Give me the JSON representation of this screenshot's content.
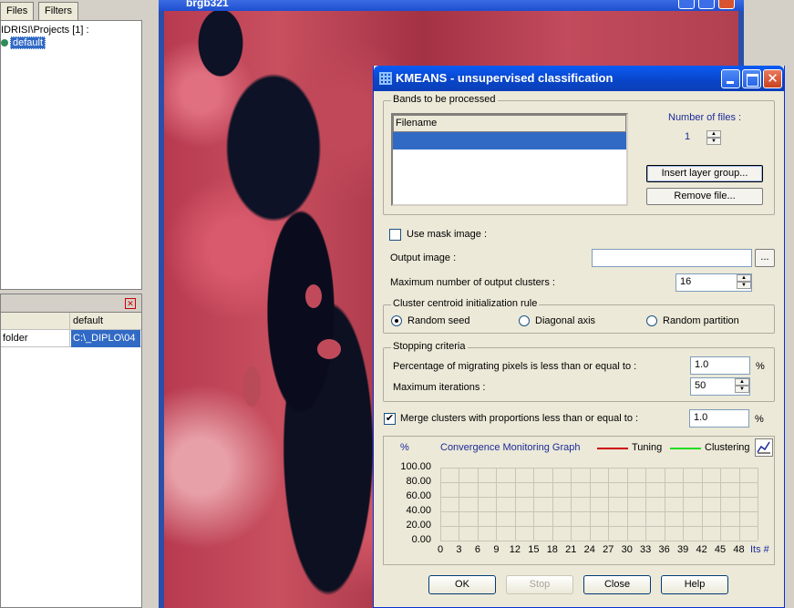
{
  "explorer": {
    "tabs": [
      "Files",
      "Filters"
    ],
    "tree_root": "IDRISI\\Projects [1] :",
    "tree_child": "default",
    "props_header": [
      "",
      "default"
    ],
    "props_row": [
      "folder",
      "C:\\_DIPLO\\04"
    ]
  },
  "image_window": {
    "title": "brgb321"
  },
  "dialog": {
    "title": "KMEANS - unsupervised classification",
    "bands_group": "Bands to be processed",
    "filename_header": "Filename",
    "num_files_label": "Number of files :",
    "num_files_value": "1",
    "insert_layer_group": "Insert layer group...",
    "remove_file": "Remove file...",
    "use_mask_label": "Use mask image :",
    "output_image_label": "Output image :",
    "output_image_value": "",
    "browse_label": "...",
    "max_clusters_label": "Maximum number of output clusters :",
    "max_clusters_value": "16",
    "init_group": "Cluster centroid initialization rule",
    "init_options": [
      "Random seed",
      "Diagonal axis",
      "Random partition"
    ],
    "init_selected": "Random seed",
    "stop_group": "Stopping criteria",
    "pct_label": "Percentage of migrating pixels is less than or equal to :",
    "pct_value": "1.0",
    "pct_unit": "%",
    "max_iter_label": "Maximum iterations :",
    "max_iter_value": "50",
    "merge_label": "Merge clusters with proportions less than or equal to :",
    "merge_checked": true,
    "merge_value": "1.0",
    "merge_unit": "%",
    "buttons": {
      "ok": "OK",
      "stop": "Stop",
      "close": "Close",
      "help": "Help"
    }
  },
  "chart_data": {
    "type": "line",
    "title": "Convergence Monitoring Graph",
    "ylabel": "%",
    "xlabel": "Its #",
    "ylim": [
      0,
      100
    ],
    "yticks": [
      "100.00",
      "80.00",
      "60.00",
      "40.00",
      "20.00",
      "0.00"
    ],
    "xticks": [
      "0",
      "3",
      "6",
      "9",
      "12",
      "15",
      "18",
      "21",
      "24",
      "27",
      "30",
      "33",
      "36",
      "39",
      "42",
      "45",
      "48"
    ],
    "series": [
      {
        "name": "Tuning",
        "color": "#cc0000",
        "values": []
      },
      {
        "name": "Clustering",
        "color": "#00cc00",
        "values": []
      }
    ],
    "grid": true,
    "legend": "top-right"
  },
  "colors": {
    "titlebar": "#0a5bf5",
    "selection": "#316ac5",
    "dialog_bg": "#ece9d8"
  }
}
